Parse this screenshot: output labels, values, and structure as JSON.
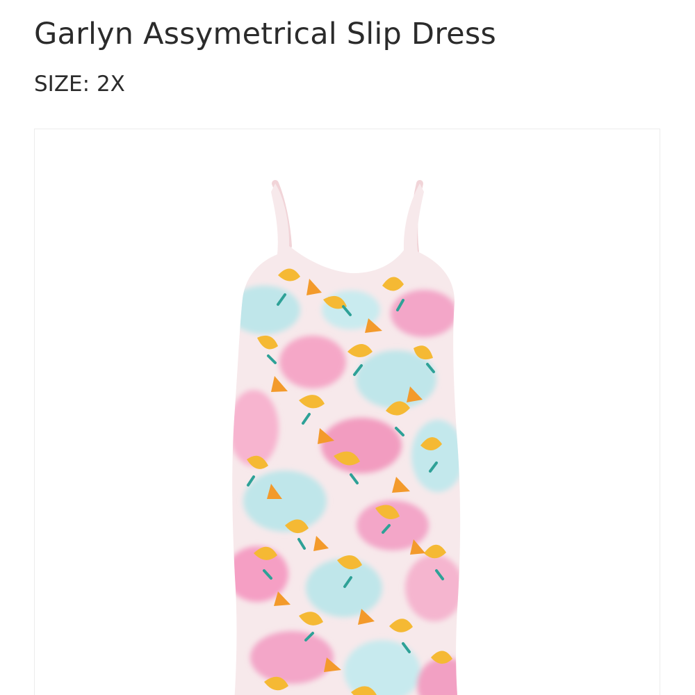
{
  "product": {
    "title": "Garlyn Assymetrical Slip Dress",
    "size_text": "SIZE: 2X"
  },
  "image": {
    "alt": "Floral print slip dress",
    "icon": "dress-photo"
  },
  "colors": {
    "text": "#2b2b2b",
    "border": "#ececec",
    "pink": "#f3a6c8",
    "yellow": "#f5b934",
    "orange": "#f39a2b",
    "aqua": "#bfe6ea",
    "teal": "#2ea197",
    "blush": "#f8e7ea"
  }
}
